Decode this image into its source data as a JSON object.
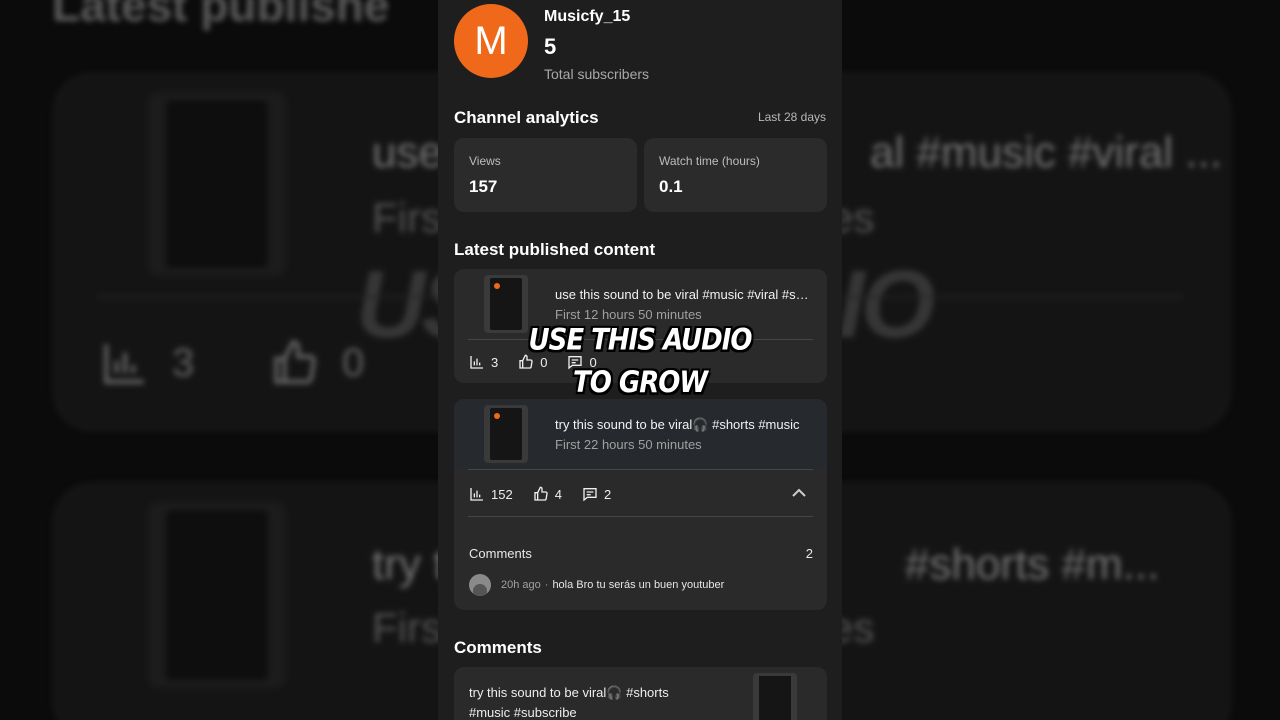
{
  "background": {
    "heading_fragment": "Latest publishe",
    "card1_title_left": "use",
    "card1_title_right": "al #music #viral ...",
    "card1_sub_left": "First",
    "card1_sub_right": "es",
    "card1_big_left": "USE",
    "card1_big_right": "IO",
    "card1_views": "3",
    "card1_likes": "0",
    "card2_title_left": "try t",
    "card2_title_right": "#shorts  #m...",
    "card2_sub_left": "Firs",
    "card2_sub_right": "es"
  },
  "channel": {
    "avatar_letter": "M",
    "name": "Musicfy_15",
    "subscribers": "5",
    "subscribers_label": "Total subscribers"
  },
  "analytics": {
    "heading": "Channel analytics",
    "range": "Last 28 days",
    "views_label": "Views",
    "views_value": "157",
    "watch_label": "Watch time (hours)",
    "watch_value": "0.1"
  },
  "latest": {
    "heading": "Latest published content",
    "items": [
      {
        "title": "use this sound to be viral #music #viral #shorts",
        "subtitle": "First 12 hours 50 minutes",
        "views": "3",
        "likes": "0",
        "comments": "0"
      },
      {
        "title": "try this sound to be viral🎧 #shorts  #music",
        "subtitle": "First 22 hours 50 minutes",
        "views": "152",
        "likes": "4",
        "comments": "2",
        "comments_label": "Comments",
        "comments_count": "2",
        "comment_time": "20h ago",
        "comment_text": "hola Bro tu serás un buen youtuber"
      }
    ]
  },
  "comments_section": {
    "heading": "Comments",
    "card_line1": "try this sound to be viral🎧 #shorts",
    "card_line2": "#music #subscribe"
  },
  "caption": {
    "line1": "USE THIS AUDIO",
    "line2": "TO GROW"
  },
  "colors": {
    "avatar": "#f0691a",
    "panel": "#1e1e1e",
    "card": "#2a2a2a"
  }
}
